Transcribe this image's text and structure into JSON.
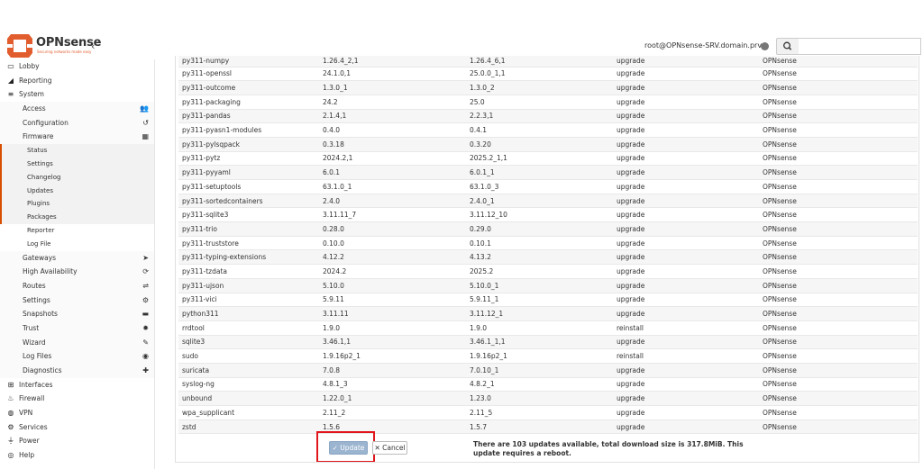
{
  "brand": {
    "name": "OPNsense",
    "tagline": "Securing networks made easy",
    "accent": "#e25d2e"
  },
  "header": {
    "user": "root@OPNsense-SRV.domain.prv",
    "search_placeholder": ""
  },
  "sidebar": {
    "items": [
      {
        "label": "Lobby",
        "icon": "laptop-icon",
        "level": 0
      },
      {
        "label": "Reporting",
        "icon": "area-chart-icon",
        "level": 0
      },
      {
        "label": "System",
        "icon": "server-icon",
        "level": 0
      },
      {
        "label": "Access",
        "icon": "users-icon",
        "level": 1
      },
      {
        "label": "Configuration",
        "icon": "history-icon",
        "level": 1
      },
      {
        "label": "Firmware",
        "icon": "building-icon",
        "level": 1
      },
      {
        "label": "Status",
        "level": 2
      },
      {
        "label": "Settings",
        "level": 2
      },
      {
        "label": "Changelog",
        "level": 2
      },
      {
        "label": "Updates",
        "level": 2
      },
      {
        "label": "Plugins",
        "level": 2
      },
      {
        "label": "Packages",
        "level": 2
      },
      {
        "label": "Reporter",
        "level": 2,
        "plain": true
      },
      {
        "label": "Log File",
        "level": 2,
        "plain": true
      },
      {
        "label": "Gateways",
        "icon": "location-arrow-icon",
        "level": 1
      },
      {
        "label": "High Availability",
        "icon": "refresh-icon",
        "level": 1
      },
      {
        "label": "Routes",
        "icon": "map-signs-icon",
        "level": 1
      },
      {
        "label": "Settings",
        "icon": "cogs-icon",
        "level": 1
      },
      {
        "label": "Snapshots",
        "icon": "hdd-icon",
        "level": 1
      },
      {
        "label": "Trust",
        "icon": "certificate-icon",
        "level": 1
      },
      {
        "label": "Wizard",
        "icon": "magic-icon",
        "level": 1
      },
      {
        "label": "Log Files",
        "icon": "eye-icon",
        "level": 1
      },
      {
        "label": "Diagnostics",
        "icon": "medkit-icon",
        "level": 1
      },
      {
        "label": "Interfaces",
        "icon": "sitemap-icon",
        "level": 0
      },
      {
        "label": "Firewall",
        "icon": "fire-icon",
        "level": 0
      },
      {
        "label": "VPN",
        "icon": "globe-icon",
        "level": 0
      },
      {
        "label": "Services",
        "icon": "cog-icon",
        "level": 0
      },
      {
        "label": "Power",
        "icon": "plug-icon",
        "level": 0
      },
      {
        "label": "Help",
        "icon": "support-icon",
        "level": 0
      }
    ]
  },
  "packages": [
    [
      "py311-numpy",
      "1.26.4_2,1",
      "1.26.4_6,1",
      "upgrade",
      "OPNsense"
    ],
    [
      "py311-openssl",
      "24.1.0,1",
      "25.0.0_1,1",
      "upgrade",
      "OPNsense"
    ],
    [
      "py311-outcome",
      "1.3.0_1",
      "1.3.0_2",
      "upgrade",
      "OPNsense"
    ],
    [
      "py311-packaging",
      "24.2",
      "25.0",
      "upgrade",
      "OPNsense"
    ],
    [
      "py311-pandas",
      "2.1.4,1",
      "2.2.3,1",
      "upgrade",
      "OPNsense"
    ],
    [
      "py311-pyasn1-modules",
      "0.4.0",
      "0.4.1",
      "upgrade",
      "OPNsense"
    ],
    [
      "py311-pylsqpack",
      "0.3.18",
      "0.3.20",
      "upgrade",
      "OPNsense"
    ],
    [
      "py311-pytz",
      "2024.2,1",
      "2025.2_1,1",
      "upgrade",
      "OPNsense"
    ],
    [
      "py311-pyyaml",
      "6.0.1",
      "6.0.1_1",
      "upgrade",
      "OPNsense"
    ],
    [
      "py311-setuptools",
      "63.1.0_1",
      "63.1.0_3",
      "upgrade",
      "OPNsense"
    ],
    [
      "py311-sortedcontainers",
      "2.4.0",
      "2.4.0_1",
      "upgrade",
      "OPNsense"
    ],
    [
      "py311-sqlite3",
      "3.11.11_7",
      "3.11.12_10",
      "upgrade",
      "OPNsense"
    ],
    [
      "py311-trio",
      "0.28.0",
      "0.29.0",
      "upgrade",
      "OPNsense"
    ],
    [
      "py311-truststore",
      "0.10.0",
      "0.10.1",
      "upgrade",
      "OPNsense"
    ],
    [
      "py311-typing-extensions",
      "4.12.2",
      "4.13.2",
      "upgrade",
      "OPNsense"
    ],
    [
      "py311-tzdata",
      "2024.2",
      "2025.2",
      "upgrade",
      "OPNsense"
    ],
    [
      "py311-ujson",
      "5.10.0",
      "5.10.0_1",
      "upgrade",
      "OPNsense"
    ],
    [
      "py311-vici",
      "5.9.11",
      "5.9.11_1",
      "upgrade",
      "OPNsense"
    ],
    [
      "python311",
      "3.11.11",
      "3.11.12_1",
      "upgrade",
      "OPNsense"
    ],
    [
      "rrdtool",
      "1.9.0",
      "1.9.0",
      "reinstall",
      "OPNsense"
    ],
    [
      "sqlite3",
      "3.46.1,1",
      "3.46.1_1,1",
      "upgrade",
      "OPNsense"
    ],
    [
      "sudo",
      "1.9.16p2_1",
      "1.9.16p2_1",
      "reinstall",
      "OPNsense"
    ],
    [
      "suricata",
      "7.0.8",
      "7.0.10_1",
      "upgrade",
      "OPNsense"
    ],
    [
      "syslog-ng",
      "4.8.1_3",
      "4.8.2_1",
      "upgrade",
      "OPNsense"
    ],
    [
      "unbound",
      "1.22.0_1",
      "1.23.0",
      "upgrade",
      "OPNsense"
    ],
    [
      "wpa_supplicant",
      "2.11_2",
      "2.11_5",
      "upgrade",
      "OPNsense"
    ],
    [
      "zstd",
      "1.5.6",
      "1.5.7",
      "upgrade",
      "OPNsense"
    ]
  ],
  "footer": {
    "update_label": "✓ Update",
    "cancel_label": "✕ Cancel",
    "message": "There are 103 updates available, total download size is 317.8MiB. This update requires a reboot."
  }
}
